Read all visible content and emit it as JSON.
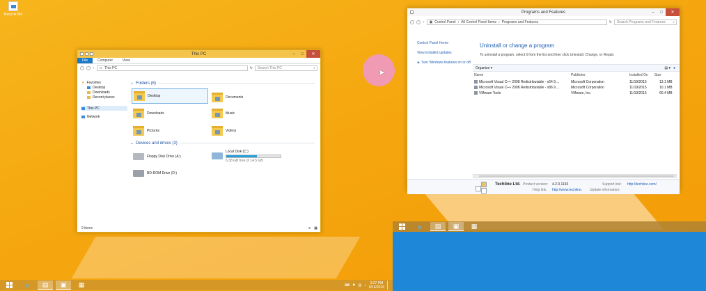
{
  "desktop": {
    "icon_label": "Recycle Bin"
  },
  "explorer": {
    "title": "This PC",
    "tabs": [
      "File",
      "Computer",
      "View"
    ],
    "address": "This PC",
    "search_placeholder": "Search This PC",
    "nav": {
      "favorites": "Favorites",
      "desktop": "Desktop",
      "downloads": "Downloads",
      "recent": "Recent places",
      "this_pc": "This PC",
      "network": "Network"
    },
    "folders_header": "Folders (6)",
    "folders": [
      "Desktop",
      "Documents",
      "Downloads",
      "Music",
      "Pictures",
      "Videos"
    ],
    "drives_header": "Devices and drives (3)",
    "drives": {
      "floppy": "Floppy Disk Drive (A:)",
      "local": "Local Disk (C:)",
      "local_space": "6.38 GB free of 14.5 GB",
      "local_used_fraction": 0.56,
      "bd": "BD-ROM Drive (D:)"
    },
    "status": "9 items"
  },
  "programs": {
    "title": "Programs and Features",
    "breadcrumb": [
      "Control Panel",
      "All Control Panel Items",
      "Programs and Features"
    ],
    "search_placeholder": "Search Programs and Features",
    "left": {
      "home": "Control Panel Home",
      "updates": "View installed updates",
      "features": "Turn Windows features on or off"
    },
    "heading": "Uninstall or change a program",
    "description": "To uninstall a program, select it from the list and then click Uninstall, Change, or Repair.",
    "organize": "Organize",
    "columns": {
      "name": "Name",
      "publisher": "Publisher",
      "installed": "Installed On",
      "size": "Size"
    },
    "rows": [
      {
        "name": "Microsoft Visual C++ 2008 Redistributable - x64 9....",
        "publisher": "Microsoft Corporation",
        "installed": "11/19/2015",
        "size": "13.1 MB"
      },
      {
        "name": "Microsoft Visual C++ 2008 Redistributable - x86 9....",
        "publisher": "Microsoft Corporation",
        "installed": "11/19/2015",
        "size": "10.1 MB"
      },
      {
        "name": "VMware Tools",
        "publisher": "VMware, Inc.",
        "installed": "11/19/2015",
        "size": "60.4 MB"
      }
    ],
    "details": {
      "company": "Techline Ltd.",
      "product_version_label": "Product version:",
      "product_version": "4.2.0.1192",
      "help_link_label": "Help link:",
      "help_link": "http://www.techline.",
      "support_link_label": "Support link:",
      "support_link": "http://techline.com/",
      "update_label": "Update information:"
    }
  },
  "taskbar": {
    "time": "3:27 PM",
    "date": "9/16/2016"
  }
}
